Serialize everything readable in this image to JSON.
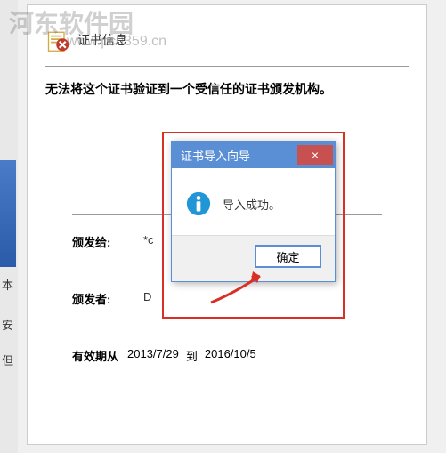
{
  "watermark": {
    "text": "河东软件园",
    "url": "www.pc0359.cn"
  },
  "sidebar": {
    "char1": "本",
    "char2": "安",
    "char3": "但"
  },
  "cert": {
    "header_title": "证书信息",
    "warning": "无法将这个证书验证到一个受信任的证书颁发机构。",
    "issued_to_label": "颁发给:",
    "issued_to_value": "*c",
    "issued_by_label": "颁发者:",
    "issued_by_value": "D",
    "validity_label": "有效期从",
    "validity_from": "2013/7/29",
    "validity_to_label": "到",
    "validity_to": "2016/10/5"
  },
  "dialog": {
    "title": "证书导入向导",
    "message": "导入成功。",
    "ok_button": "确定",
    "close_symbol": "×"
  }
}
